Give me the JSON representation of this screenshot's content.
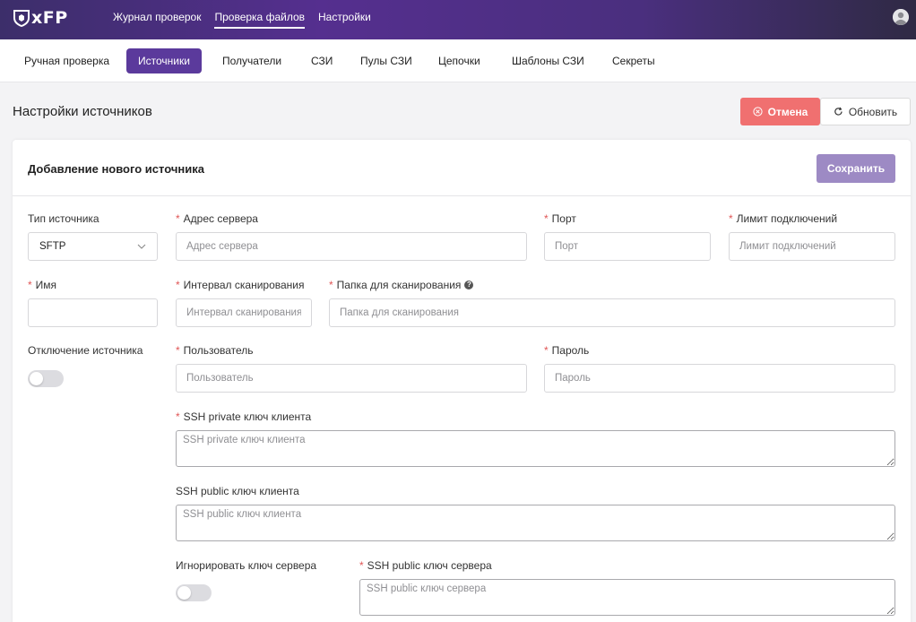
{
  "app": {
    "logo_text": "xFP",
    "top_nav": [
      {
        "label": "Журнал проверок",
        "active": false
      },
      {
        "label": "Проверка файлов",
        "active": true
      },
      {
        "label": "Настройки",
        "active": false
      }
    ]
  },
  "subnav": {
    "tabs": [
      {
        "label": "Ручная проверка",
        "active": false
      },
      {
        "label": "Источники",
        "active": true
      },
      {
        "label": "Получатели",
        "active": false
      },
      {
        "label": "СЗИ",
        "active": false
      },
      {
        "label": "Пулы СЗИ",
        "active": false
      },
      {
        "label": "Цепочки",
        "active": false
      },
      {
        "label": "Шаблоны СЗИ",
        "active": false
      },
      {
        "label": "Секреты",
        "active": false
      }
    ]
  },
  "page": {
    "title": "Настройки источников",
    "cancel_label": "Отмена",
    "refresh_label": "Обновить"
  },
  "form": {
    "title": "Добавление нового источника",
    "save_label": "Сохранить",
    "source_type": {
      "label": "Тип источника",
      "value": "SFTP"
    },
    "server_address": {
      "label": "Адрес сервера",
      "placeholder": "Адрес сервера",
      "required": true
    },
    "port": {
      "label": "Порт",
      "placeholder": "Порт",
      "required": true
    },
    "connection_limit": {
      "label": "Лимит подключений",
      "placeholder": "Лимит подключений",
      "required": true
    },
    "name": {
      "label": "Имя",
      "value": "",
      "required": true
    },
    "scan_interval": {
      "label": "Интервал сканирования",
      "placeholder": "Интервал сканирования",
      "required": true
    },
    "scan_folder": {
      "label": "Папка для сканирования",
      "placeholder": "Папка для сканирования",
      "required": true
    },
    "disable_source": {
      "label": "Отключение источника",
      "enabled": false
    },
    "user": {
      "label": "Пользователь",
      "placeholder": "Пользователь",
      "required": true
    },
    "password": {
      "label": "Пароль",
      "placeholder": "Пароль",
      "required": true
    },
    "ssh_private_client": {
      "label": "SSH private ключ клиента",
      "placeholder": "SSH private ключ клиента",
      "required": true
    },
    "ssh_public_client": {
      "label": "SSH public ключ клиента",
      "placeholder": "SSH public ключ клиента",
      "required": false
    },
    "ignore_server_key": {
      "label": "Игнорировать ключ сервера",
      "enabled": false
    },
    "ssh_public_server": {
      "label": "SSH public ключ сервера",
      "placeholder": "SSH public ключ сервера",
      "required": true
    }
  },
  "colors": {
    "accent": "#5b3a9c",
    "cancel": "#f07070",
    "save": "#9d8ac4",
    "required": "#e05555"
  }
}
